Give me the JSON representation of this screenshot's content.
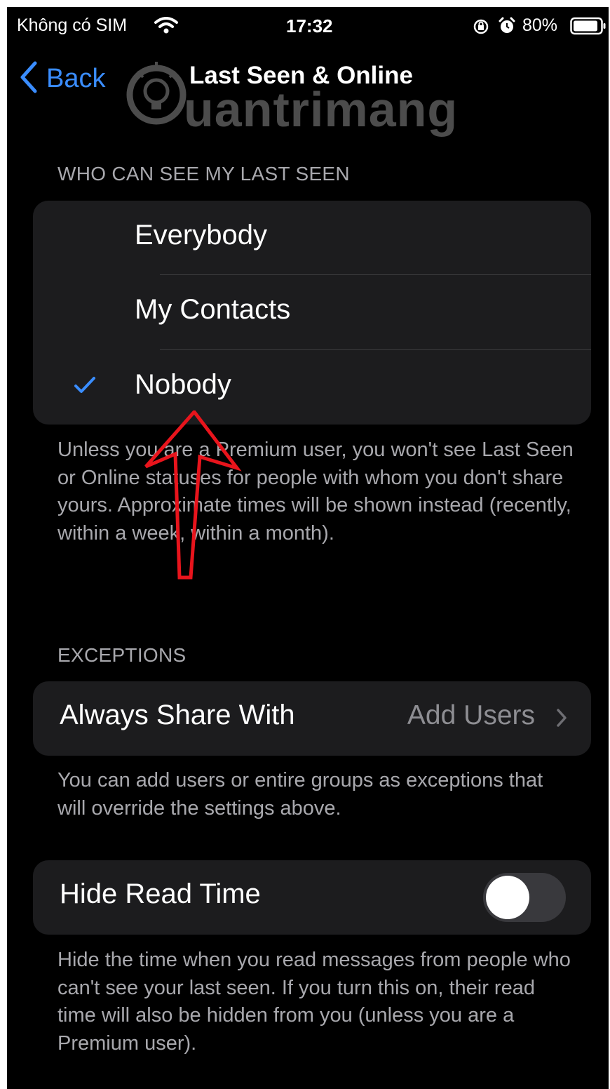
{
  "status_bar": {
    "carrier": "Không có SIM",
    "time": "17:32",
    "battery": "80%"
  },
  "nav": {
    "back_label": "Back",
    "title": "Last Seen & Online"
  },
  "watermark": {
    "text": "uantrimang"
  },
  "last_seen_section": {
    "header": "WHO CAN SEE MY LAST SEEN",
    "options": [
      {
        "label": "Everybody",
        "selected": false
      },
      {
        "label": "My Contacts",
        "selected": false
      },
      {
        "label": "Nobody",
        "selected": true
      }
    ],
    "footer": "Unless you are a Premium user, you won't see Last Seen or Online statuses for people with whom you don't share yours. Approximate times will be shown instead (recently, within a week, within a month)."
  },
  "exceptions_section": {
    "header": "EXCEPTIONS",
    "row_label": "Always Share With",
    "row_value": "Add Users",
    "footer": "You can add users or entire groups as exceptions that will override the settings above."
  },
  "read_time_section": {
    "row_label": "Hide Read Time",
    "toggle_on": false,
    "footer": "Hide the time when you read messages from people who can't see your last seen. If you turn this on, their read time will also be hidden from you (unless you are a Premium user)."
  },
  "colors": {
    "accent": "#3a8dff",
    "background": "#000000",
    "cell": "#1c1c1e",
    "secondary_text": "#a8a8ad",
    "annotation": "#e8141c"
  }
}
